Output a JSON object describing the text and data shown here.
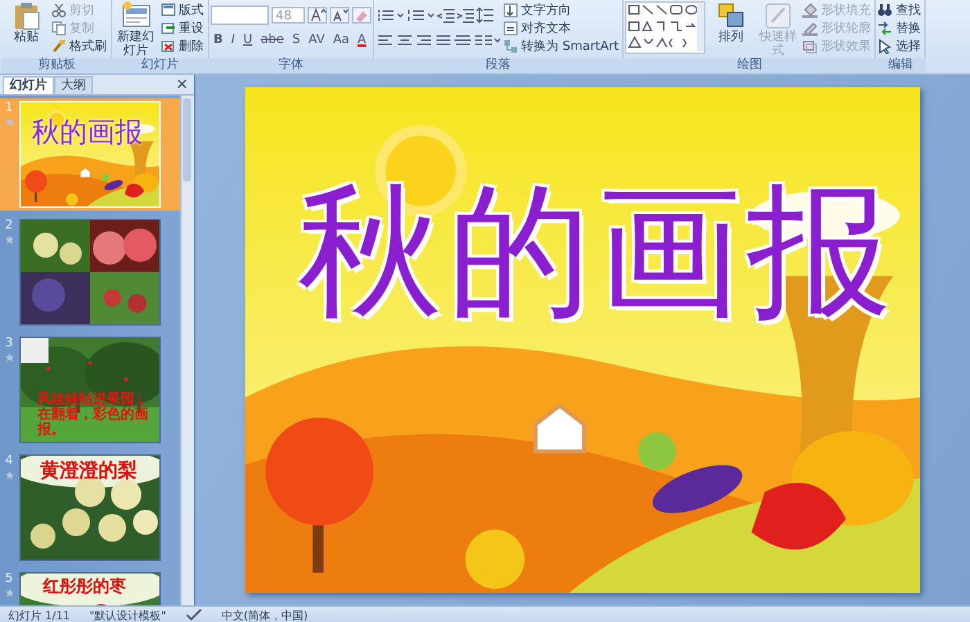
{
  "ribbon": {
    "groups": [
      {
        "kind": "clipboard",
        "label": "剪贴板",
        "large": [
          {
            "label": "粘贴",
            "disabled": false
          }
        ],
        "small": [
          {
            "label": "剪切",
            "disabled": true
          },
          {
            "label": "复制",
            "disabled": true
          },
          {
            "label": "格式刷",
            "disabled": false
          }
        ]
      },
      {
        "kind": "slides",
        "label": "幻灯片",
        "large": [
          {
            "label": "新建幻灯片",
            "disabled": false
          }
        ],
        "small": [
          {
            "label": "版式",
            "disabled": false
          },
          {
            "label": "重设",
            "disabled": false
          },
          {
            "label": "删除",
            "disabled": false
          }
        ]
      },
      {
        "kind": "font",
        "label": "字体",
        "font_size": "48",
        "format_buttons": [
          "B",
          "I",
          "U",
          "abe",
          "S",
          "AV",
          "Aa",
          "A"
        ]
      },
      {
        "kind": "paragraph",
        "label": "段落",
        "small": [
          {
            "label": "文字方向",
            "disabled": false
          },
          {
            "label": "对齐文本",
            "disabled": false
          },
          {
            "label": "转换为 SmartArt",
            "disabled": false
          }
        ]
      },
      {
        "kind": "drawing",
        "label": "绘图",
        "large": [
          {
            "label": "排列",
            "disabled": false
          },
          {
            "label": "快速样式",
            "disabled": true
          }
        ],
        "small": [
          {
            "label": "形状填充",
            "disabled": true
          },
          {
            "label": "形状轮廓",
            "disabled": true
          },
          {
            "label": "形状效果",
            "disabled": true
          }
        ]
      },
      {
        "kind": "editing",
        "label": "编辑",
        "small": [
          {
            "label": "查找",
            "disabled": false
          },
          {
            "label": "替换",
            "disabled": false
          },
          {
            "label": "选择",
            "disabled": false
          }
        ]
      }
    ]
  },
  "slides_panel": {
    "tabs": [
      {
        "label": "幻灯片",
        "selected": true
      },
      {
        "label": "大纲",
        "selected": false
      }
    ],
    "close": "×",
    "slides": [
      {
        "number": "1",
        "selected": true,
        "kind": "title",
        "text": "秋的画报"
      },
      {
        "number": "2",
        "selected": false,
        "kind": "fruits"
      },
      {
        "number": "3",
        "selected": false,
        "kind": "orchard",
        "text": "风娃娃钻进果园，在翻着，彩色的画报。"
      },
      {
        "number": "4",
        "selected": false,
        "kind": "pears",
        "text": "黄澄澄的梨"
      },
      {
        "number": "5",
        "selected": false,
        "kind": "jujube",
        "text": "红彤彤的枣"
      }
    ]
  },
  "slide": {
    "title": "秋的画报"
  },
  "status_bar": {
    "slide": "幻灯片 1/11",
    "theme": "\"默认设计模板\"",
    "language": "中文(简体，中国)"
  }
}
